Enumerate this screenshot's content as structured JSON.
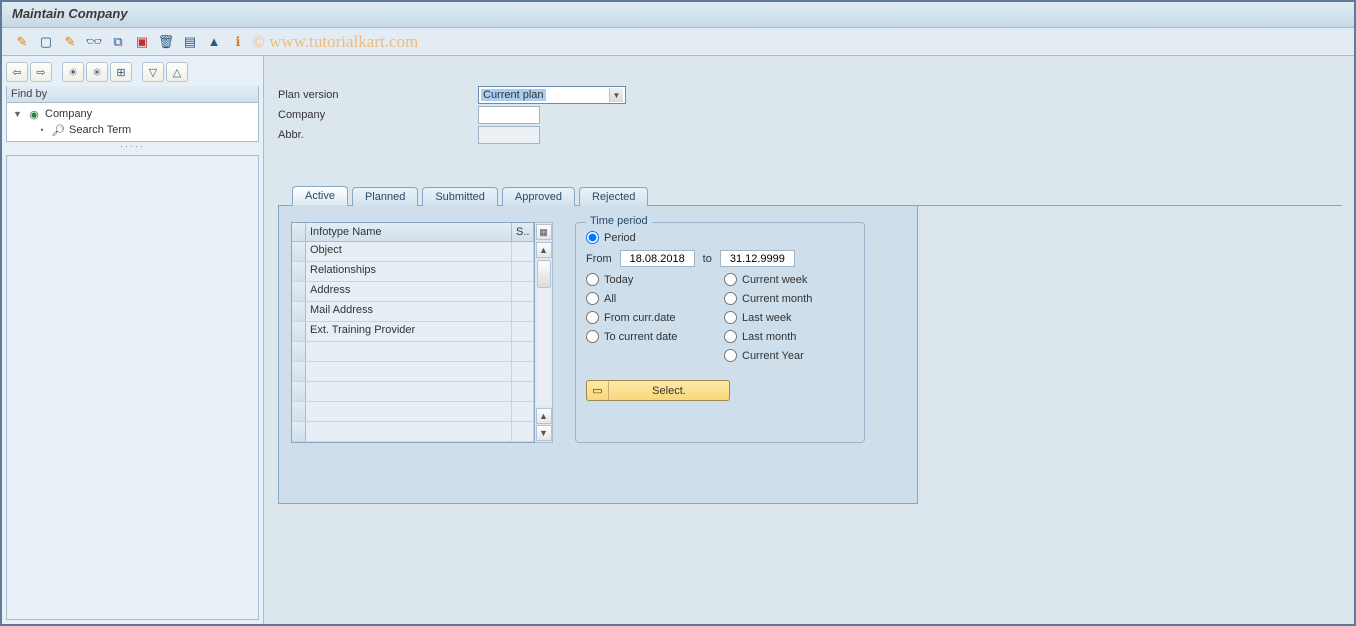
{
  "title": "Maintain Company",
  "watermark": "© www.tutorialkart.com",
  "sidebar": {
    "find_by_label": "Find by",
    "tree": {
      "company_label": "Company",
      "search_term_label": "Search Term"
    }
  },
  "form": {
    "plan_version_label": "Plan version",
    "plan_version_value": "Current plan",
    "company_label": "Company",
    "company_value": "",
    "abbr_label": "Abbr.",
    "abbr_value": ""
  },
  "tabs": {
    "active": "Active",
    "planned": "Planned",
    "submitted": "Submitted",
    "approved": "Approved",
    "rejected": "Rejected"
  },
  "infotype_table": {
    "header_name": "Infotype Name",
    "header_s": "S..",
    "rows": {
      "0": "Object",
      "1": "Relationships",
      "2": "Address",
      "3": "Mail Address",
      "4": "Ext. Training Provider"
    }
  },
  "time_period": {
    "legend": "Time period",
    "period": "Period",
    "from_label": "From",
    "from_value": "18.08.2018",
    "to_label": "to",
    "to_value": "31.12.9999",
    "today": "Today",
    "all": "All",
    "from_curr": "From curr.date",
    "to_curr": "To current date",
    "curr_week": "Current week",
    "curr_month": "Current month",
    "last_week": "Last week",
    "last_month": "Last month",
    "curr_year": "Current Year",
    "select_btn": "Select."
  }
}
